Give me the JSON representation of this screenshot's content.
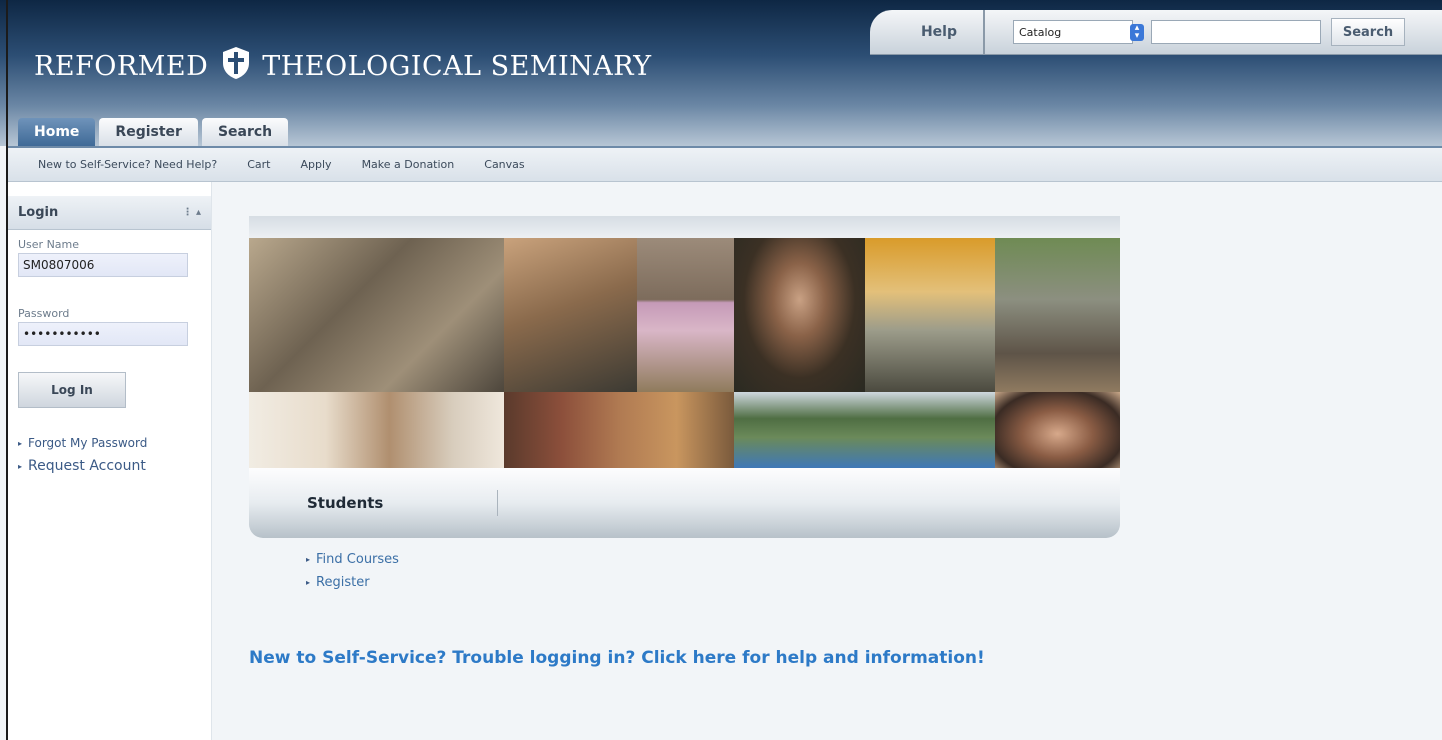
{
  "brand": {
    "name_left": "REFORMED",
    "name_right": "THEOLOGICAL SEMINARY"
  },
  "utility": {
    "help_label": "Help",
    "catalog_value": "Catalog",
    "search_placeholder": "",
    "search_label": "Search"
  },
  "tabs": [
    {
      "label": "Home",
      "active": true
    },
    {
      "label": "Register",
      "active": false
    },
    {
      "label": "Search",
      "active": false
    }
  ],
  "subnav": [
    "New to Self-Service? Need Help?",
    "Cart",
    "Apply",
    "Make a Donation",
    "Canvas"
  ],
  "login": {
    "title": "Login",
    "controls": "⋮ ▴",
    "username_label": "User Name",
    "username_value": "SM0807006",
    "password_label": "Password",
    "password_value": "•••••••••••",
    "button_label": "Log In",
    "links": [
      "Forgot My Password",
      "Request Account"
    ]
  },
  "banner": {
    "section_label": "Students"
  },
  "student_links": [
    "Find Courses",
    "Register"
  ],
  "help_message": "New to Self-Service? Trouble logging in? Click here for help and information!",
  "colors": {
    "header_dark": "#0e2744",
    "link": "#2d7ac7",
    "tab_active": "#3f6a97"
  }
}
